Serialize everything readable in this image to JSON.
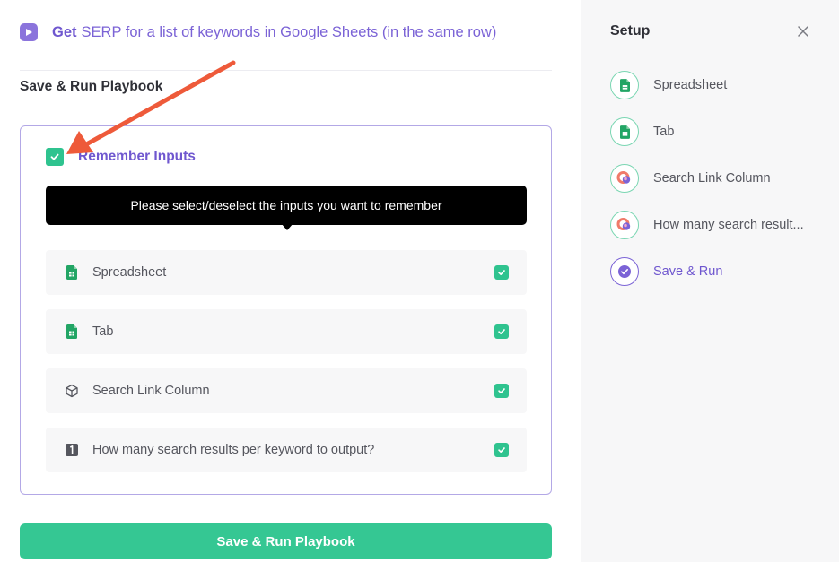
{
  "playbook": {
    "verb": "Get",
    "title": "SERP for a list of keywords in Google Sheets (in the same row)"
  },
  "section_title": "Save & Run Playbook",
  "remember": {
    "label": "Remember Inputs",
    "checked": true,
    "tooltip": "Please select/deselect the inputs you want to remember"
  },
  "inputs": [
    {
      "label": "Spreadsheet",
      "icon": "google-sheets-icon",
      "checked": true
    },
    {
      "label": "Tab",
      "icon": "google-sheets-icon",
      "checked": true
    },
    {
      "label": "Search Link Column",
      "icon": "cube-icon",
      "checked": true
    },
    {
      "label": "How many search results per keyword to output?",
      "icon": "number-one-icon",
      "checked": true
    }
  ],
  "save_button": "Save & Run Playbook",
  "setup": {
    "title": "Setup",
    "steps": [
      {
        "label": "Spreadsheet",
        "icon": "google-sheets-icon"
      },
      {
        "label": "Tab",
        "icon": "google-sheets-icon"
      },
      {
        "label": "Search Link Column",
        "icon": "bardeen-logo-icon"
      },
      {
        "label": "How many search result...",
        "icon": "bardeen-logo-icon"
      },
      {
        "label": "Save & Run",
        "icon": "check-circle-icon",
        "active": true
      }
    ]
  },
  "colors": {
    "accent": "#6f57cf",
    "primary_green": "#35c793",
    "checkbox_green": "#2fc38f",
    "annotation_arrow": "#ee5a3a"
  }
}
